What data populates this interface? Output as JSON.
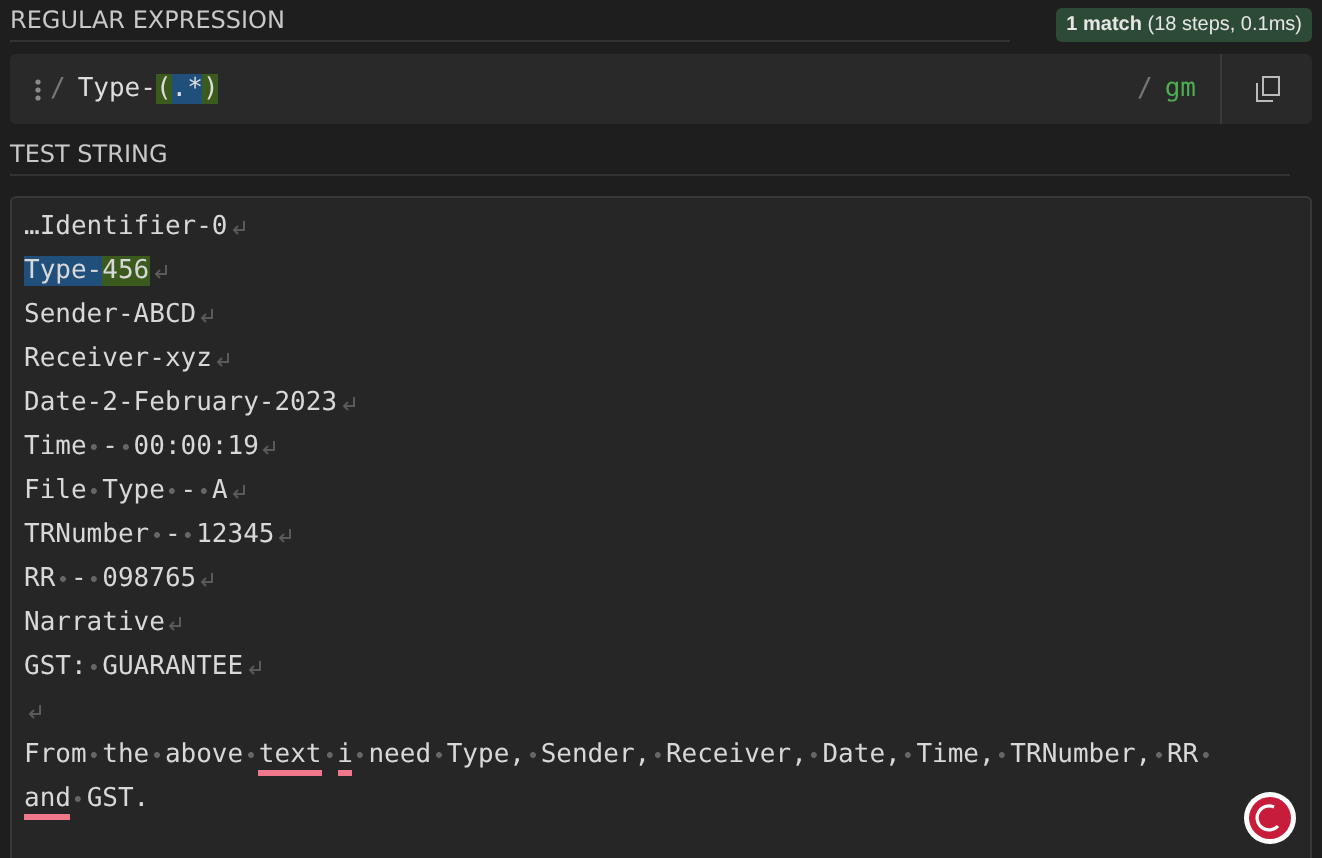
{
  "regex_section": {
    "title": "REGULAR EXPRESSION",
    "match_info": "**1 match** (18 steps, 0.1ms)",
    "open_delimiter": "/",
    "pattern": [
      {
        "text": "Type-",
        "kind": "plain"
      },
      {
        "text": "(",
        "kind": "group"
      },
      {
        "text": ".*",
        "kind": "match"
      },
      {
        "text": ")",
        "kind": "group"
      }
    ],
    "close_delimiter": "/",
    "flags": "gm"
  },
  "test_section": {
    "title": "TEST STRING",
    "lines": [
      {
        "segments": [
          {
            "text": "…Identifier-0",
            "kind": "plain"
          }
        ],
        "newline": true
      },
      {
        "segments": [
          {
            "text": "Type-",
            "kind": "match"
          },
          {
            "text": "456",
            "kind": "group"
          }
        ],
        "newline": true
      },
      {
        "segments": [
          {
            "text": "Sender-ABCD",
            "kind": "plain"
          }
        ],
        "newline": true
      },
      {
        "segments": [
          {
            "text": "Receiver-xyz",
            "kind": "plain"
          }
        ],
        "newline": true
      },
      {
        "segments": [
          {
            "text": "Date-2-February-2023",
            "kind": "plain"
          }
        ],
        "newline": true
      },
      {
        "segments": [
          {
            "text": "Time - 00:00:19",
            "kind": "plain"
          }
        ],
        "newline": true
      },
      {
        "segments": [
          {
            "text": "File Type - A",
            "kind": "plain"
          }
        ],
        "newline": true
      },
      {
        "segments": [
          {
            "text": "TRNumber - 12345",
            "kind": "plain"
          }
        ],
        "newline": true
      },
      {
        "segments": [
          {
            "text": "RR - 098765",
            "kind": "plain"
          }
        ],
        "newline": true
      },
      {
        "segments": [
          {
            "text": "Narrative",
            "kind": "plain"
          }
        ],
        "newline": true
      },
      {
        "segments": [
          {
            "text": "GST: GUARANTEE",
            "kind": "plain"
          }
        ],
        "newline": true
      },
      {
        "newline": true
      },
      {
        "segments": [
          {
            "text": "From the above ",
            "kind": "plain"
          },
          {
            "text": "text ",
            "kind": "spell"
          },
          {
            "text": "i ",
            "kind": "spell"
          },
          {
            "text": "need Type, Sender, Receiver, Date, Time, TRNumber, RR ",
            "kind": "plain"
          },
          {
            "text": "and",
            "kind": "spell"
          },
          {
            "text": " GST.",
            "kind": "plain"
          }
        ],
        "newline": false
      }
    ]
  }
}
